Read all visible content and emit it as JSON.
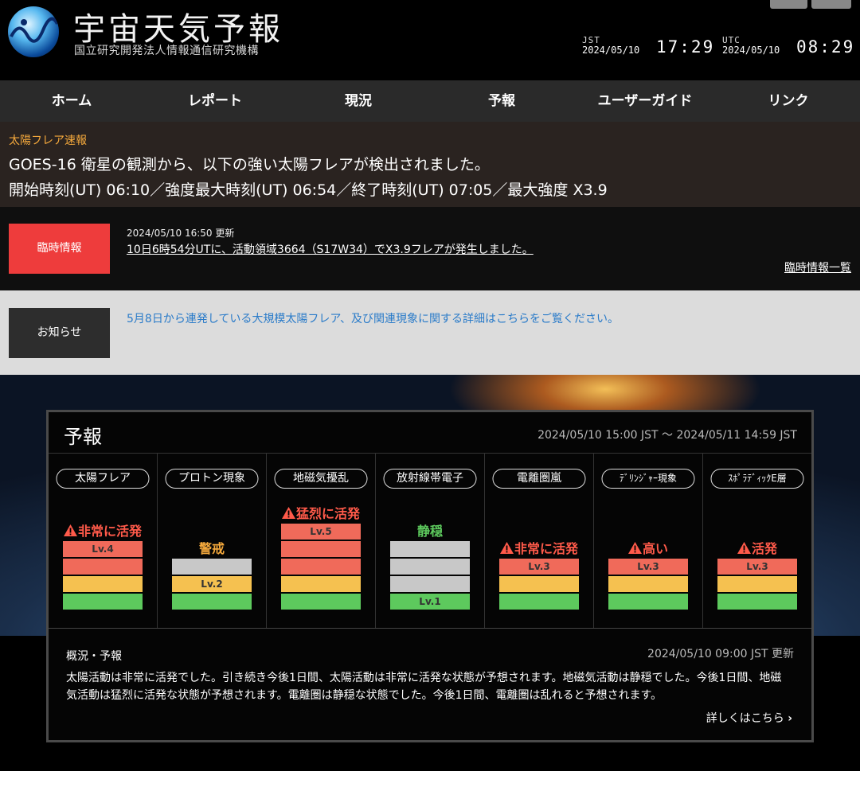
{
  "header": {
    "title": "宇宙天気予報",
    "subtitle": "国立研究開発法人情報通信研究機構",
    "jst_label": "JST",
    "jst_date": "2024/05/10",
    "jst_time": "17:29",
    "utc_label": "UTC",
    "utc_date": "2024/05/10",
    "utc_time": "08:29"
  },
  "nav": [
    "ホーム",
    "レポート",
    "現況",
    "予報",
    "ユーザーガイド",
    "リンク"
  ],
  "flare_alert": {
    "tag": "太陽フレア速報",
    "line1": "GOES-16 衛星の観測から、以下の強い太陽フレアが検出されました。",
    "line2": "開始時刻(UT) 06:10／強度最大時刻(UT) 06:54／終了時刻(UT) 07:05／最大強度 X3.9"
  },
  "temp_info": {
    "button": "臨時情報",
    "date": "2024/05/10 16:50 更新",
    "link": "10日6時54分UTに、活動領域3664（S17W34）でX3.9フレアが発生しました。",
    "list_link": "臨時情報一覧"
  },
  "notice": {
    "button": "お知らせ",
    "text": "5月8日から連発している大規模太陽フレア、及び関連現象に関する詳細はこちらをご覧ください。"
  },
  "forecast": {
    "title": "予報",
    "range": "2024/05/10 15:00 JST 〜 2024/05/11 14:59 JST",
    "colors": {
      "red": "#f06a5a",
      "orange": "#f5c150",
      "green": "#5dc95d",
      "gray": "#c8c8c8",
      "status_red": "#ff5a4a",
      "status_orange": "#f5a93c",
      "status_green": "#5dc95d"
    },
    "items": [
      {
        "name": "太陽フレア",
        "status": "非常に活発",
        "warn": true,
        "status_color": "red",
        "level_label": "Lv.4",
        "bars": [
          "red",
          "red",
          "orange",
          "green"
        ],
        "label_index": 0
      },
      {
        "name": "プロトン現象",
        "status": "警戒",
        "warn": false,
        "status_color": "orange",
        "level_label": "Lv.2",
        "bars": [
          "gray",
          "orange",
          "green"
        ],
        "label_index": 1
      },
      {
        "name": "地磁気擾乱",
        "status": "猛烈に活発",
        "warn": true,
        "status_color": "red",
        "level_label": "Lv.5",
        "bars": [
          "red",
          "red",
          "red",
          "orange",
          "green"
        ],
        "label_index": 0
      },
      {
        "name": "放射線帯電子",
        "status": "静穏",
        "warn": false,
        "status_color": "green",
        "level_label": "Lv.1",
        "bars": [
          "gray",
          "gray",
          "gray",
          "green"
        ],
        "label_index": 3
      },
      {
        "name": "電離圏嵐",
        "status": "非常に活発",
        "warn": true,
        "status_color": "red",
        "level_label": "Lv.3",
        "bars": [
          "red",
          "orange",
          "green"
        ],
        "label_index": 0
      },
      {
        "name": "ﾃﾞﾘﾝｼﾞｬｰ現象",
        "status": "高い",
        "warn": true,
        "status_color": "red",
        "level_label": "Lv.3",
        "bars": [
          "red",
          "orange",
          "green"
        ],
        "label_index": 0
      },
      {
        "name": "ｽﾎﾟﾗﾃﾞｨｯｸE層",
        "status": "活発",
        "warn": true,
        "status_color": "red",
        "level_label": "Lv.3",
        "bars": [
          "red",
          "orange",
          "green"
        ],
        "label_index": 0
      }
    ],
    "summary": {
      "title": "概況・予報",
      "updated": "2024/05/10 09:00 JST 更新",
      "body": "太陽活動は非常に活発でした。引き続き今後1日間、太陽活動は非常に活発な状態が予想されます。地磁気活動は静穏でした。今後1日間、地磁気活動は猛烈に活発な状態が予想されます。電離圏は静穏な状態でした。今後1日間、電離圏は乱れると予想されます。",
      "more": "詳しくはこちら"
    }
  }
}
